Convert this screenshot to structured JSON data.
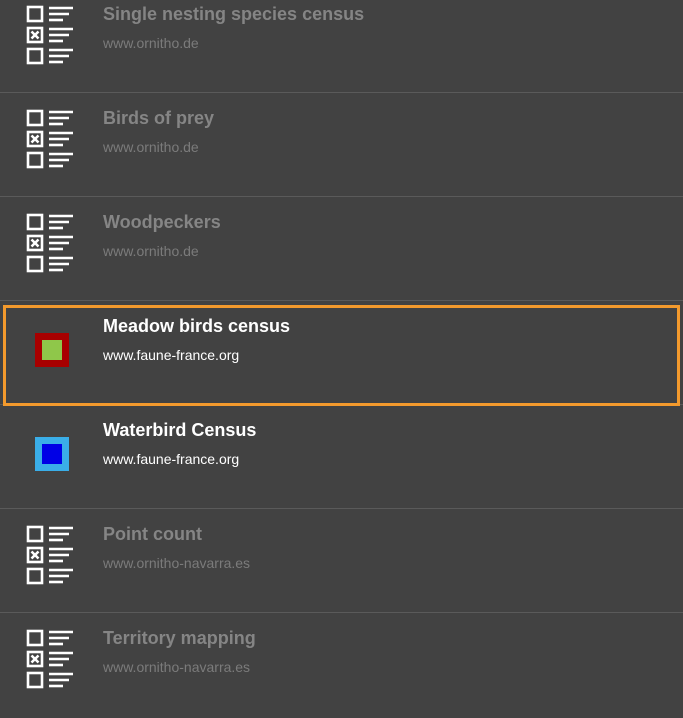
{
  "items": [
    {
      "title": "Single nesting species census",
      "source": "www.ornitho.de",
      "icon": "checklist-icon",
      "active": false
    },
    {
      "title": "Birds of prey",
      "source": "www.ornitho.de",
      "icon": "checklist-icon",
      "active": false
    },
    {
      "title": "Woodpeckers",
      "source": "www.ornitho.de",
      "icon": "checklist-icon",
      "active": false
    },
    {
      "title": "Meadow birds census",
      "source": "www.faune-france.org",
      "icon": "colored-square-icon",
      "active": true,
      "selected": true,
      "icon_colors": {
        "outer": "#a80000",
        "inner": "#8fc74a"
      }
    },
    {
      "title": "Waterbird Census",
      "source": "www.faune-france.org",
      "icon": "colored-square-icon",
      "active": true,
      "icon_colors": {
        "outer": "#3aaee8",
        "inner": "#0000e6"
      }
    },
    {
      "title": "Point count",
      "source": "www.ornitho-navarra.es",
      "icon": "checklist-icon",
      "active": false
    },
    {
      "title": "Territory mapping",
      "source": "www.ornitho-navarra.es",
      "icon": "checklist-icon",
      "active": false
    }
  ],
  "colors": {
    "background": "#424242",
    "divider": "#5a5a5a",
    "selection_border": "#f39a2d",
    "inactive_text": "#858585",
    "active_text": "#ffffff"
  }
}
